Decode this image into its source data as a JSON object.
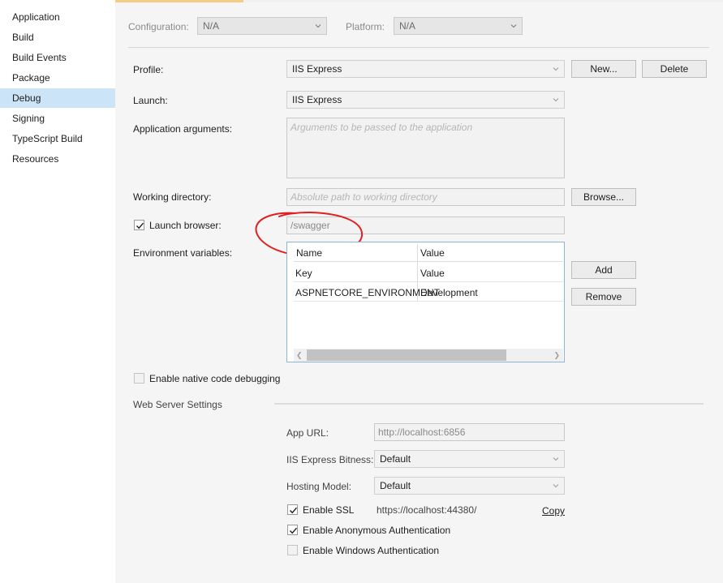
{
  "sidebar": {
    "items": [
      {
        "label": "Application"
      },
      {
        "label": "Build"
      },
      {
        "label": "Build Events"
      },
      {
        "label": "Package"
      },
      {
        "label": "Debug"
      },
      {
        "label": "Signing"
      },
      {
        "label": "TypeScript Build"
      },
      {
        "label": "Resources"
      }
    ],
    "selected": "Debug"
  },
  "config": {
    "configuration_label": "Configuration:",
    "configuration_value": "N/A",
    "platform_label": "Platform:",
    "platform_value": "N/A"
  },
  "profile": {
    "label": "Profile:",
    "value": "IIS Express",
    "new_button": "New...",
    "delete_button": "Delete"
  },
  "launch": {
    "label": "Launch:",
    "value": "IIS Express"
  },
  "app_args": {
    "label": "Application arguments:",
    "placeholder": "Arguments to be passed to the application"
  },
  "working_dir": {
    "label": "Working directory:",
    "placeholder": "Absolute path to working directory",
    "browse_button": "Browse..."
  },
  "launch_browser": {
    "label": "Launch browser:",
    "checked": true,
    "value": "/swagger"
  },
  "env_vars": {
    "label": "Environment variables:",
    "columns": [
      "Name",
      "Value"
    ],
    "rows": [
      {
        "name": "Key",
        "value": "Value"
      },
      {
        "name": "ASPNETCORE_ENVIRONMENT",
        "value": "Development"
      }
    ],
    "add_button": "Add",
    "remove_button": "Remove"
  },
  "native_debug": {
    "label": "Enable native code debugging",
    "checked": false
  },
  "web_server": {
    "section_title": "Web Server Settings",
    "app_url_label": "App URL:",
    "app_url_value": "http://localhost:6856",
    "bitness_label": "IIS Express Bitness:",
    "bitness_value": "Default",
    "hosting_label": "Hosting Model:",
    "hosting_value": "Default",
    "ssl_label": "Enable SSL",
    "ssl_checked": true,
    "ssl_url": "https://localhost:44380/",
    "copy_link": "Copy",
    "anon_auth_label": "Enable Anonymous Authentication",
    "anon_auth_checked": true,
    "windows_auth_label": "Enable Windows Authentication",
    "windows_auth_checked": false
  },
  "colors": {
    "selected_nav": "#cce4f7",
    "annotation_circle": "#e02020",
    "grid_border": "#8ab4d8"
  }
}
